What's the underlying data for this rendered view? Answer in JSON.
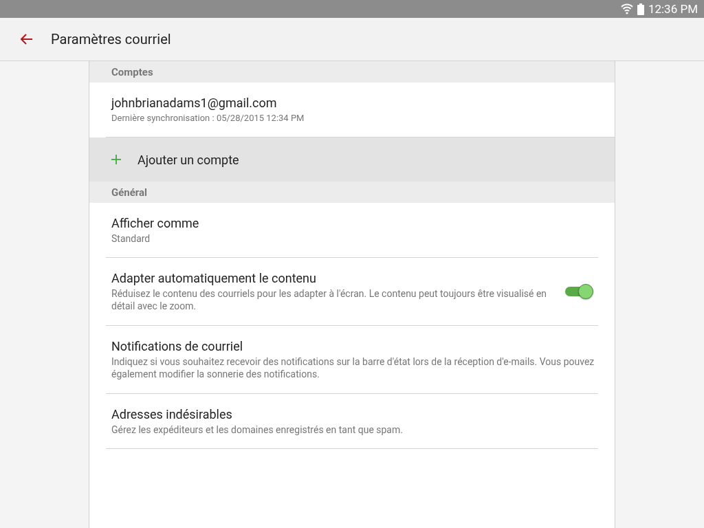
{
  "status_bar": {
    "time": "12:36 PM"
  },
  "app_bar": {
    "title": "Paramètres courriel"
  },
  "sections": [
    {
      "header": "Comptes",
      "items": [
        {
          "kind": "account",
          "title": "johnbrianadams1@gmail.com",
          "subtitle": "Dernière synchronisation : 05/28/2015 12:34 PM"
        },
        {
          "kind": "add",
          "title": "Ajouter un compte"
        }
      ]
    },
    {
      "header": "Général",
      "items": [
        {
          "kind": "text",
          "title": "Afficher comme",
          "subtitle": "Standard"
        },
        {
          "kind": "switch",
          "title": "Adapter automatiquement le contenu",
          "subtitle": "Réduisez le contenu des courriels pour les adapter à l'écran. Le contenu peut toujours être visualisé en détail avec le zoom.",
          "on": true
        },
        {
          "kind": "text",
          "title": "Notifications de courriel",
          "subtitle": "Indiquez si vous souhaitez recevoir des notifications sur la barre d'état lors de la réception d'e-mails. Vous pouvez également modifier la sonnerie des notifications."
        },
        {
          "kind": "text",
          "title": "Adresses indésirables",
          "subtitle": "Gérez les expéditeurs et les domaines enregistrés en tant que spam."
        }
      ]
    }
  ]
}
